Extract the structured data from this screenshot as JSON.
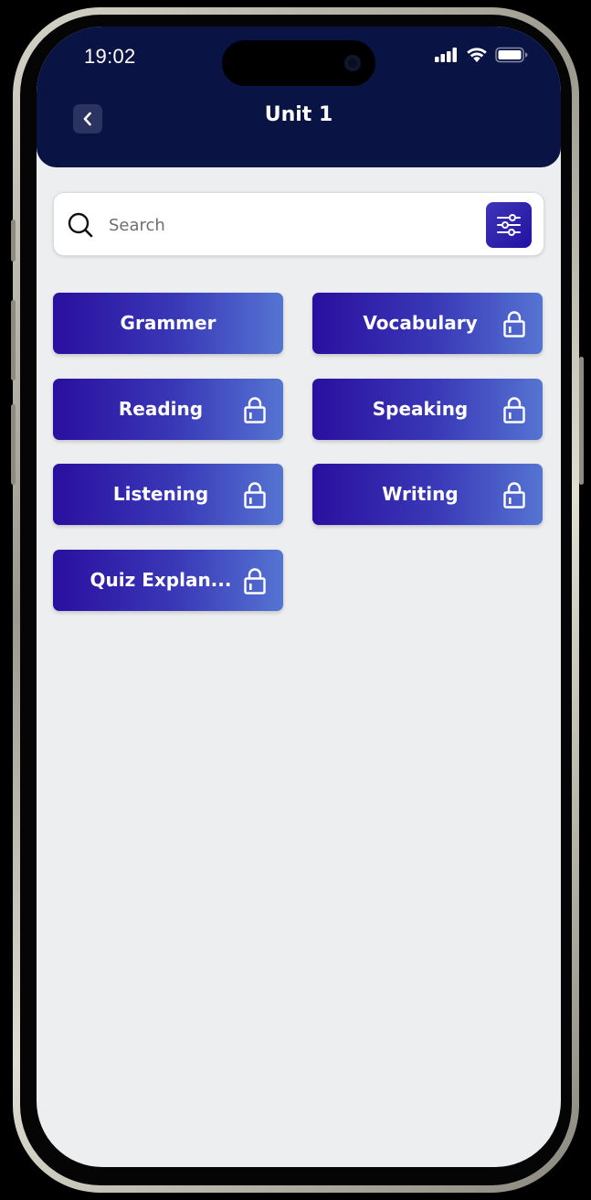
{
  "status_bar": {
    "time": "19:02"
  },
  "header": {
    "title": "Unit 1"
  },
  "search": {
    "placeholder": "Search",
    "value": ""
  },
  "topics": [
    {
      "label": "Grammer",
      "locked": false
    },
    {
      "label": "Vocabulary",
      "locked": true
    },
    {
      "label": "Reading",
      "locked": true
    },
    {
      "label": "Speaking",
      "locked": true
    },
    {
      "label": "Listening",
      "locked": true
    },
    {
      "label": "Writing",
      "locked": true
    },
    {
      "label": "Quiz Explan...",
      "locked": true
    }
  ],
  "icons": {
    "back": "chevron-left-icon",
    "search": "search-icon",
    "filter": "sliders-icon",
    "lock": "lock-icon"
  },
  "colors": {
    "header_bg": "#0a1444",
    "screen_bg": "#edeef0",
    "button_gradient_start": "#2a0f9f",
    "button_gradient_end": "#5574d2"
  }
}
